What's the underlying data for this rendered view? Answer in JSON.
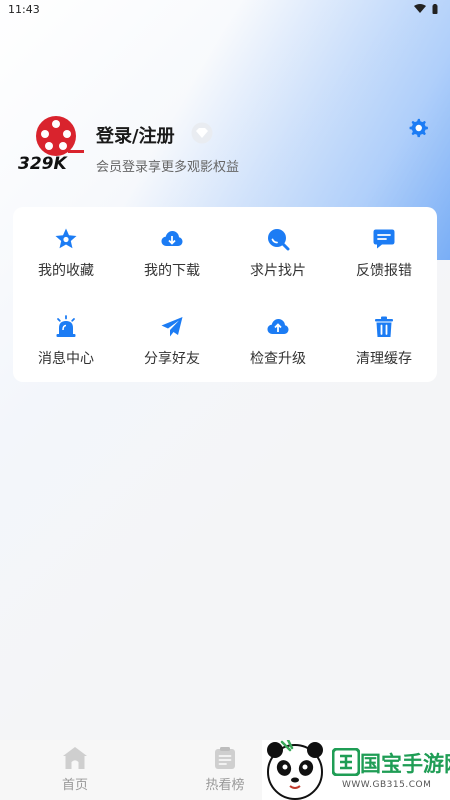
{
  "status": {
    "time": "11:43"
  },
  "profile": {
    "logo_text": "329K",
    "login_label": "登录/注册",
    "subtitle": "会员登录享更多观影权益"
  },
  "menu": [
    {
      "label": "我的收藏",
      "icon": "favorite-star-icon"
    },
    {
      "label": "我的下载",
      "icon": "cloud-download-icon"
    },
    {
      "label": "求片找片",
      "icon": "search-icon"
    },
    {
      "label": "反馈报错",
      "icon": "feedback-chat-icon"
    },
    {
      "label": "消息中心",
      "icon": "siren-icon"
    },
    {
      "label": "分享好友",
      "icon": "paper-plane-icon"
    },
    {
      "label": "检查升级",
      "icon": "cloud-upload-icon"
    },
    {
      "label": "清理缓存",
      "icon": "trash-icon"
    }
  ],
  "tabs": [
    {
      "label": "首页",
      "icon": "home-icon"
    },
    {
      "label": "热看榜",
      "icon": "clipboard-icon"
    }
  ],
  "watermark": {
    "brand": "国宝手游网",
    "url": "WWW.GB315.COM"
  },
  "colors": {
    "accent": "#1c7cf4",
    "logo_red": "#d9232d"
  }
}
